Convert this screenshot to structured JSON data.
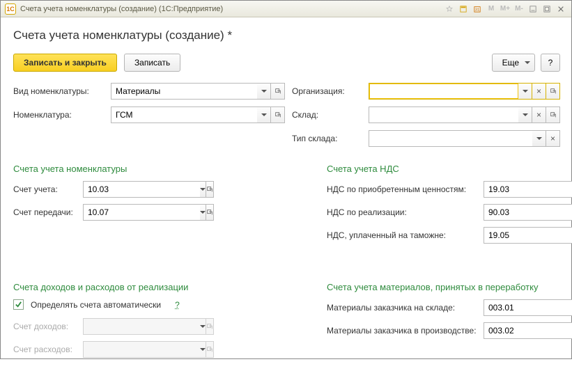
{
  "titlebar": {
    "logo_text": "1C",
    "title": "Счета учета номенклатуры (создание)  (1С:Предприятие)",
    "m_buttons": [
      "M",
      "M+",
      "M-"
    ]
  },
  "page_title": "Счета учета номенклатуры (создание) *",
  "toolbar": {
    "save_close": "Записать и закрыть",
    "save": "Записать",
    "more": "Еще",
    "help": "?"
  },
  "fields_top": {
    "vid_nomen_label": "Вид номенклатуры:",
    "vid_nomen_value": "Материалы",
    "nomen_label": "Номенклатура:",
    "nomen_value": "ГСМ",
    "org_label": "Организация:",
    "org_value": "",
    "sklad_label": "Склад:",
    "sklad_value": "",
    "tip_sklada_label": "Тип склада:",
    "tip_sklada_value": ""
  },
  "section_accounts": {
    "title": "Счета учета номенклатуры",
    "rows": [
      {
        "label": "Счет учета:",
        "value": "10.03"
      },
      {
        "label": "Счет передачи:",
        "value": "10.07"
      }
    ]
  },
  "section_vat": {
    "title": "Счета учета НДС",
    "rows": [
      {
        "label": "НДС по приобретенным ценностям:",
        "value": "19.03"
      },
      {
        "label": "НДС по реализации:",
        "value": "90.03"
      },
      {
        "label": "НДС, уплаченный на таможне:",
        "value": "19.05"
      }
    ]
  },
  "section_income": {
    "title": "Счета доходов и расходов от реализации",
    "checkbox_label": "Определять счета автоматически",
    "checkbox_checked": true,
    "help": "?",
    "rows": [
      {
        "label": "Счет доходов:",
        "value": ""
      },
      {
        "label": "Счет расходов:",
        "value": ""
      }
    ]
  },
  "section_materials": {
    "title": "Счета учета материалов, принятых в переработку",
    "rows": [
      {
        "label": "Материалы заказчика на складе:",
        "value": "003.01"
      },
      {
        "label": "Материалы заказчика в производстве:",
        "value": "003.02"
      }
    ]
  }
}
